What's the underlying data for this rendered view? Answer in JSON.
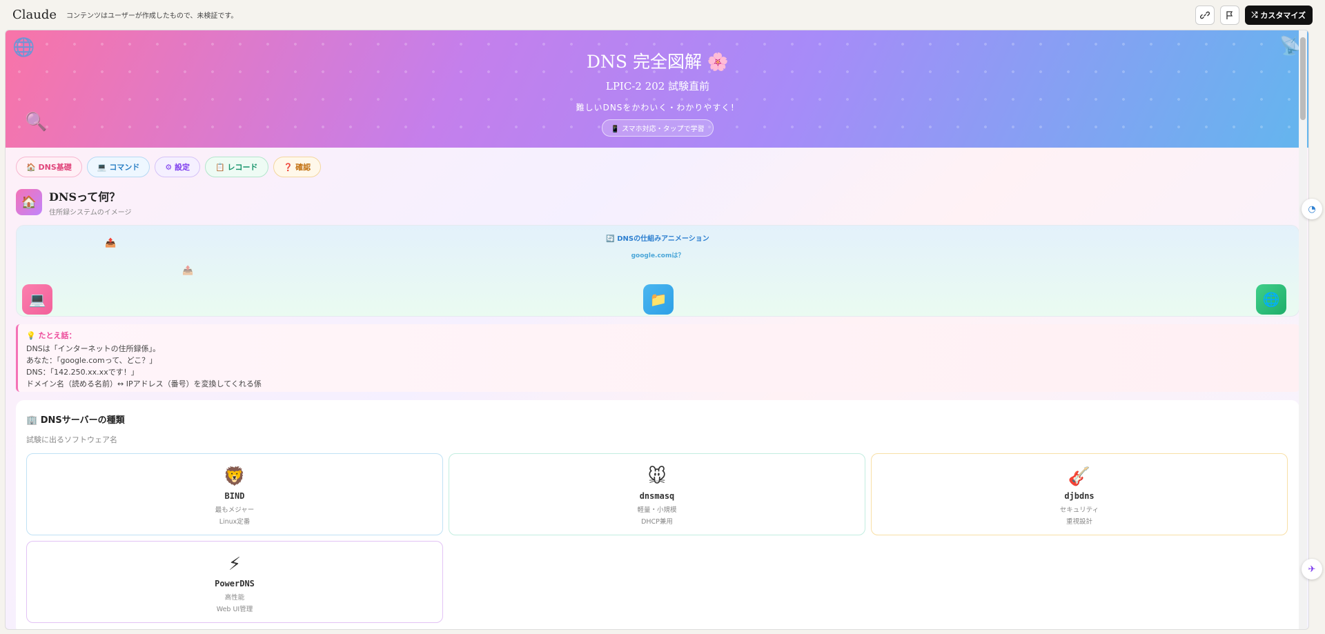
{
  "topbar": {
    "logo": "Claude",
    "notice": "コンテンツはユーザーが作成したもので、未検証です。",
    "customize_label": "カスタマイズ"
  },
  "hero": {
    "title": "DNS 完全図解 🌸",
    "subtitle": "LPIC-2 202 試験直前",
    "desc": "難しいDNSをかわいく・わかりやすく！",
    "badge": "📱 スマホ対応・タップで学習"
  },
  "tabs": [
    {
      "label": "🏠 DNS基礎",
      "color": "#e0457b",
      "bg": "#fff0f6",
      "border": "#f7b6cf"
    },
    {
      "label": "💻 コマンド",
      "color": "#2a7fc4",
      "bg": "#eef7ff",
      "border": "#b6d9f3"
    },
    {
      "label": "⚙ 設定",
      "color": "#7c3aed",
      "bg": "#f5f0ff",
      "border": "#d5c2f7"
    },
    {
      "label": "📋 レコード",
      "color": "#15936a",
      "bg": "#eefbf4",
      "border": "#b3e6cc"
    },
    {
      "label": "❓ 確認",
      "color": "#c2700f",
      "bg": "#fff8ea",
      "border": "#f3d69f"
    }
  ],
  "section": {
    "icon": "🏠",
    "title": "DNSって何？",
    "subtitle": "住所録システムのイメージ"
  },
  "animation": {
    "title": "🔄 DNSの仕組みアニメーション",
    "question": "google.comは？",
    "nodes": [
      {
        "icon": "💻",
        "bg": "linear-gradient(135deg,#fb7fae,#f2609a)"
      },
      {
        "icon": "📁",
        "bg": "linear-gradient(135deg,#4ab6f0,#2ea0e6)"
      },
      {
        "icon": "🌐",
        "bg": "linear-gradient(135deg,#3fcf8a,#1fae6a)"
      }
    ]
  },
  "analogy": {
    "title": "💡 たとえ話：",
    "lines": [
      "DNSは「インターネットの住所録係」。",
      "あなた：「google.comって、どこ？」",
      "DNS：「142.250.xx.xxです！」",
      "ドメイン名（読める名前）↔ IPアドレス（番号）を変換してくれる係"
    ]
  },
  "servers": {
    "title": "🏢 DNSサーバーの種類",
    "subtitle": "試験に出るソフトウェア名",
    "cards": [
      {
        "icon": "🦁",
        "name": "BIND",
        "line1": "最もメジャー",
        "line2": "Linux定番",
        "border": "#bfe1f5"
      },
      {
        "icon": "🐭",
        "name": "dnsmasq",
        "line1": "軽量・小規模",
        "line2": "DHCP兼用",
        "border": "#c2ede0"
      },
      {
        "icon": "🎸",
        "name": "djbdns",
        "line1": "セキュリティ",
        "line2": "重視設計",
        "border": "#f8dfa5"
      },
      {
        "icon": "⚡",
        "name": "PowerDNS",
        "line1": "高性能",
        "line2": "Web UI管理",
        "border": "#e2c2f5"
      }
    ]
  }
}
